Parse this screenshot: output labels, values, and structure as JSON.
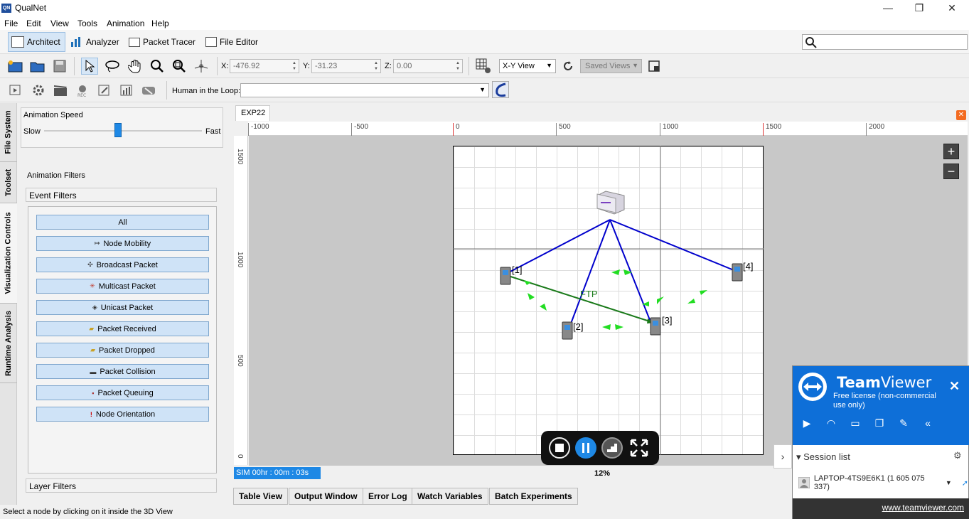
{
  "window": {
    "title": "QualNet",
    "logo_text": "QN"
  },
  "menu": [
    "File",
    "Edit",
    "View",
    "Tools",
    "Animation",
    "Help"
  ],
  "perspectives": [
    "Architect",
    "Analyzer",
    "Packet Tracer",
    "File Editor"
  ],
  "coords": {
    "x_label": "X:",
    "x_value": "-476.92",
    "y_label": "Y:",
    "y_value": "-31.23",
    "z_label": "Z:",
    "z_value": "0.00"
  },
  "view_mode": "X-Y View",
  "saved_views": "Saved Views",
  "hitl_label": "Human in the Loop:",
  "vertical_tabs": [
    "File System",
    "Toolset",
    "Visualization Controls",
    "Runtime Analysis"
  ],
  "animation": {
    "speed_title": "Animation Speed",
    "slow_label": "Slow",
    "fast_label": "Fast",
    "speed_fraction": 0.47,
    "filters_title": "Animation Filters",
    "event_filters_title": "Event Filters",
    "layer_filters_title": "Layer Filters",
    "filters": [
      {
        "label": "All",
        "mark": ""
      },
      {
        "label": "Node Mobility",
        "mark": "↦"
      },
      {
        "label": "Broadcast Packet",
        "mark": "✣"
      },
      {
        "label": "Multicast Packet",
        "mark": "✳"
      },
      {
        "label": "Unicast Packet",
        "mark": "◈"
      },
      {
        "label": "Packet Received",
        "mark": "▰"
      },
      {
        "label": "Packet Dropped",
        "mark": "▰"
      },
      {
        "label": "Packet Collision",
        "mark": "▬"
      },
      {
        "label": "Packet Queuing",
        "mark": "▪"
      },
      {
        "label": "Node Orientation",
        "mark": "!"
      }
    ]
  },
  "editor": {
    "tab": "EXP22",
    "close": "✕",
    "hruler_ticks": [
      "-1000",
      "-500",
      "0",
      "500",
      "1000",
      "1500",
      "2000"
    ],
    "vruler_ticks": [
      "1500",
      "1000",
      "500",
      "0"
    ],
    "nodes": [
      {
        "label": "[1]"
      },
      {
        "label": "[2]"
      },
      {
        "label": "[3]"
      },
      {
        "label": "[4]"
      }
    ],
    "app_link_label": "FTP",
    "zoom_in": "+",
    "zoom_out": "−",
    "sim_time": "SIM 00hr : 00m : 03s",
    "progress": "12%"
  },
  "bottom_tabs": [
    "Table View",
    "Output Window",
    "Error Log",
    "Watch Variables",
    "Batch Experiments"
  ],
  "status": "Select a node by clicking on it inside the 3D View",
  "teamviewer": {
    "name_bold": "Team",
    "name_rest": "Viewer",
    "license": "Free license (non-commercial use only)",
    "close": "✕",
    "session_list": "Session list",
    "device": "LAPTOP-4TS9E6K1 (1 605 075 337)",
    "url": "www.teamviewer.com",
    "side_arrow": "›"
  },
  "colors": {
    "accent": "#1e88e5",
    "wireless_link": "#0000cc",
    "app_link": "#1a7a1a",
    "packet": "#22dd22",
    "teamviewer": "#0e6fd8"
  }
}
